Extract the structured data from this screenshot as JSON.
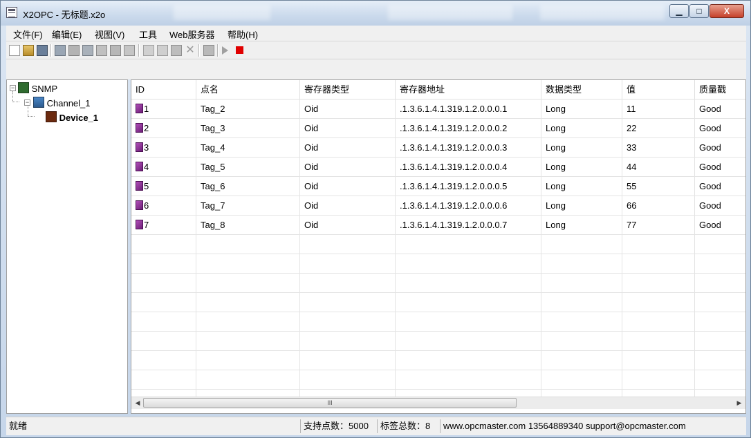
{
  "window": {
    "title": "X2OPC - 无标题.x2o",
    "minimize_glyph": "▁",
    "maximize_glyph": "□",
    "close_glyph": "X"
  },
  "menubar": {
    "items": [
      "文件(F)",
      "编辑(E)",
      "视图(V)",
      "工具",
      "Web服务器",
      "帮助(H)"
    ]
  },
  "toolbar": {
    "icons": [
      "new-file-icon",
      "open-folder-icon",
      "save-icon",
      "new-channel-icon",
      "new-device-icon",
      "device-properties-icon",
      "new-tag-icon",
      "bulk-tags-icon",
      "tag-properties-icon",
      "cut-icon",
      "copy-icon",
      "paste-icon",
      "delete-icon",
      "quick-client-icon",
      "run-icon",
      "stop-icon"
    ],
    "run_color": "#a0a0a0",
    "stop_color": "#e00000"
  },
  "tree": {
    "root": "SNMP",
    "channel": "Channel_1",
    "device": "Device_1",
    "collapse_glyph": "−"
  },
  "grid": {
    "columns": [
      "ID",
      "点名",
      "寄存器类型",
      "寄存器地址",
      "数据类型",
      "值",
      "质量戳"
    ],
    "rows": [
      {
        "id": "1",
        "name": "Tag_2",
        "reg_type": "Oid",
        "address": ".1.3.6.1.4.1.319.1.2.0.0.0.1",
        "data_type": "Long",
        "value": "11",
        "quality": "Good"
      },
      {
        "id": "2",
        "name": "Tag_3",
        "reg_type": "Oid",
        "address": ".1.3.6.1.4.1.319.1.2.0.0.0.2",
        "data_type": "Long",
        "value": "22",
        "quality": "Good"
      },
      {
        "id": "3",
        "name": "Tag_4",
        "reg_type": "Oid",
        "address": ".1.3.6.1.4.1.319.1.2.0.0.0.3",
        "data_type": "Long",
        "value": "33",
        "quality": "Good"
      },
      {
        "id": "4",
        "name": "Tag_5",
        "reg_type": "Oid",
        "address": ".1.3.6.1.4.1.319.1.2.0.0.0.4",
        "data_type": "Long",
        "value": "44",
        "quality": "Good"
      },
      {
        "id": "5",
        "name": "Tag_6",
        "reg_type": "Oid",
        "address": ".1.3.6.1.4.1.319.1.2.0.0.0.5",
        "data_type": "Long",
        "value": "55",
        "quality": "Good"
      },
      {
        "id": "6",
        "name": "Tag_7",
        "reg_type": "Oid",
        "address": ".1.3.6.1.4.1.319.1.2.0.0.0.6",
        "data_type": "Long",
        "value": "66",
        "quality": "Good"
      },
      {
        "id": "7",
        "name": "Tag_8",
        "reg_type": "Oid",
        "address": ".1.3.6.1.4.1.319.1.2.0.0.0.7",
        "data_type": "Long",
        "value": "77",
        "quality": "Good"
      }
    ],
    "scroll_left_glyph": "◀",
    "scroll_right_glyph": "▶",
    "scroll_thumb_glyph": "III"
  },
  "statusbar": {
    "ready": "就绪",
    "points_supported": "支持点数：5000",
    "tag_count": "标签总数：8",
    "contact": "www.opcmaster.com 13564889340 support@opcmaster.com"
  }
}
